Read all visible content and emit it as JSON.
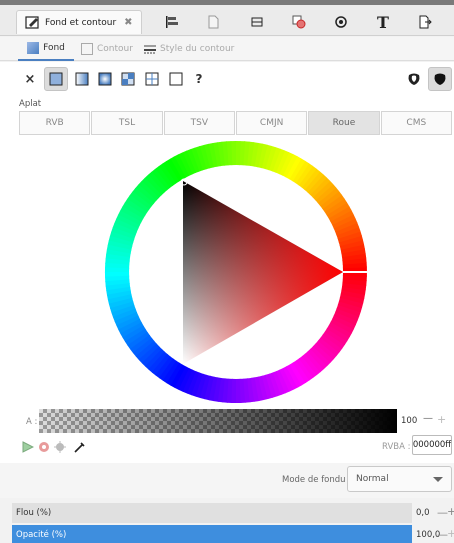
{
  "dialog_tabs": {
    "active_label": "Fond et contour",
    "close_symbol": "✖",
    "text_tab_glyph": "T"
  },
  "subtabs": {
    "fill": "Fond",
    "stroke": "Contour",
    "stroke_style": "Style du contour"
  },
  "paint": {
    "none_symbol": "×",
    "unset_symbol": "?"
  },
  "flat_color_label": "Aplat",
  "color_modes": [
    "RVB",
    "TSL",
    "TSV",
    "CMJN",
    "Roue",
    "CMS"
  ],
  "selected_mode": "Roue",
  "color": {
    "hue_hex": "#ff0000",
    "current_hex": "#000000"
  },
  "alpha": {
    "label": "A :",
    "value": "100",
    "minus": "—",
    "plus": "+"
  },
  "rgba": {
    "label": "RVBA :",
    "value": "000000ff"
  },
  "blend": {
    "label": "Mode de fondu :",
    "value": "Normal"
  },
  "blur": {
    "label": "Flou (%)",
    "value": "0,0",
    "minus": "—",
    "plus": "+"
  },
  "opacity": {
    "label": "Opacité (%)",
    "value": "100,0",
    "minus": "—",
    "plus": "+"
  },
  "accent_color": "#3e8ede"
}
